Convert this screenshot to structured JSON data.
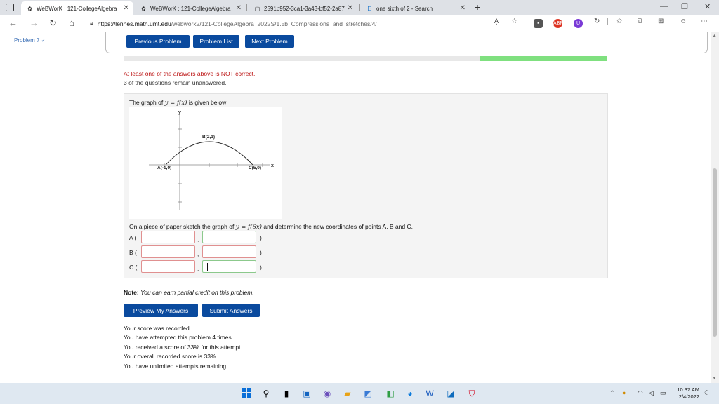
{
  "browser": {
    "tabs": [
      {
        "title": "WeBWorK : 121-CollegeAlgebra",
        "active": true
      },
      {
        "title": "WeBWorK : 121-CollegeAlgebra",
        "active": false
      },
      {
        "title": "2591b952-3ca1-3a43-bf52-2a87",
        "active": false
      },
      {
        "title": "one sixth of 2 - Search",
        "active": false
      }
    ],
    "url_host": "https://lennes.math.umt.edu",
    "url_path": "/webwork2/121-CollegeAlgebra_2022S/1.5b_Compressions_and_stretches/4/",
    "extensions": {
      "abp": "ABP",
      "u": "U"
    }
  },
  "sidebar": {
    "problem_label": "Problem 7 ✓"
  },
  "nav": {
    "previous": "Previous Problem",
    "list": "Problem List",
    "next": "Next Problem"
  },
  "messages": {
    "incorrect": "At least one of the answers above is NOT correct.",
    "unanswered": "3 of the questions remain unanswered."
  },
  "problem": {
    "intro_prefix": "The graph of ",
    "intro_math": "y = f(x)",
    "intro_suffix": " is given below:",
    "graph": {
      "y_axis_label": "y",
      "x_axis_label": "x",
      "point_a": "A(-1,0)",
      "point_b": "B(2,1)",
      "point_c": "C(5,0)"
    },
    "instruction_prefix": "On a piece of paper sketch the graph of ",
    "instruction_math": "y = f(6x)",
    "instruction_suffix": " and determine the new coordinates of points A, B and C.",
    "rows": [
      {
        "label": "A (",
        "comma": ",",
        "close": ")"
      },
      {
        "label": "B (",
        "comma": ",",
        "close": ")"
      },
      {
        "label": "C (",
        "comma": ",",
        "close": ")"
      }
    ]
  },
  "note": {
    "label": "Note:",
    "text": "You can earn partial credit on this problem."
  },
  "buttons": {
    "preview": "Preview My Answers",
    "submit": "Submit Answers"
  },
  "score_lines": [
    "Your score was recorded.",
    "You have attempted this problem 4 times.",
    "You received a score of 33% for this attempt.",
    "Your overall recorded score is 33%.",
    "You have unlimited attempts remaining."
  ],
  "taskbar": {
    "time": "10:37 AM",
    "date": "2/4/2022"
  },
  "colors": {
    "button_blue": "#0a4a9e",
    "error_red": "#b11111",
    "correct_green": "#7fe07f"
  }
}
